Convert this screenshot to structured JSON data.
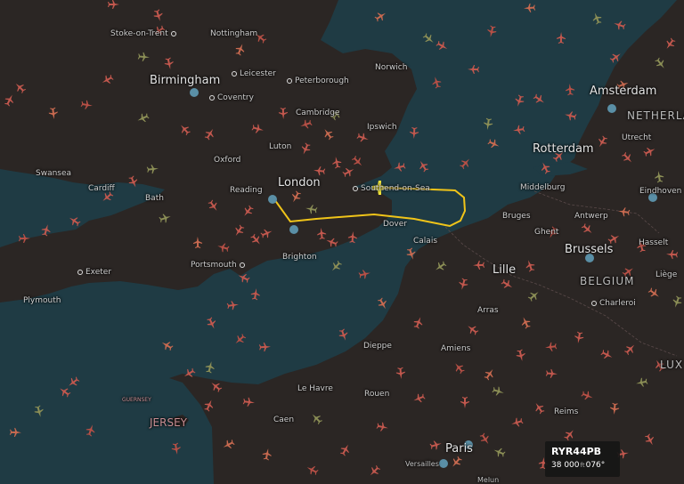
{
  "cities": {
    "london": "London",
    "birmingham": "Birmingham",
    "amsterdam": "Amsterdam",
    "rotterdam": "Rotterdam",
    "brussels": "Brussels",
    "lille": "Lille",
    "paris": "Paris",
    "stoke": "Stoke-on-Trent",
    "nottingham": "Nottingham",
    "leicester": "Leicester",
    "coventry": "Coventry",
    "peterborough": "Peterborough",
    "norwich": "Norwich",
    "cambridge": "Cambridge",
    "ipswich": "Ipswich",
    "luton": "Luton",
    "oxford": "Oxford",
    "reading": "Reading",
    "swansea": "Swansea",
    "cardiff": "Cardiff",
    "bath": "Bath",
    "southend": "Southend-on-Sea",
    "dover": "Dover",
    "calais": "Calais",
    "brighton": "Brighton",
    "portsmouth": "Portsmouth",
    "exeter": "Exeter",
    "plymouth": "Plymouth",
    "middelburg": "Middelburg",
    "bruges": "Bruges",
    "antwerp": "Antwerp",
    "ghent": "Ghent",
    "hasselt": "Hasselt",
    "utrecht": "Utrecht",
    "eindhoven": "Eindhoven",
    "liege": "Liège",
    "charleroi": "Charleroi",
    "arras": "Arras",
    "amiens": "Amiens",
    "dieppe": "Dieppe",
    "le_havre": "Le Havre",
    "rouen": "Rouen",
    "caen": "Caen",
    "reims": "Reims",
    "versailles": "Versailles",
    "melun": "Melun"
  },
  "regions": {
    "netherlands": "NETHERLA",
    "belgium": "BELGIUM",
    "luxembourg": "LUX",
    "jersey": "JERSEY",
    "guernsey": "GUERNSEY"
  },
  "selected_flight": {
    "callsign": "RYR44PB",
    "altitude": "38 000",
    "altitude_unit": "ft",
    "heading": "076°",
    "track_color": "#f0c419",
    "aircraft_color": "#f0e33a"
  },
  "colors": {
    "sea": "#1f3b44",
    "land": "#2b2624",
    "aircraft": "#c3584e"
  }
}
